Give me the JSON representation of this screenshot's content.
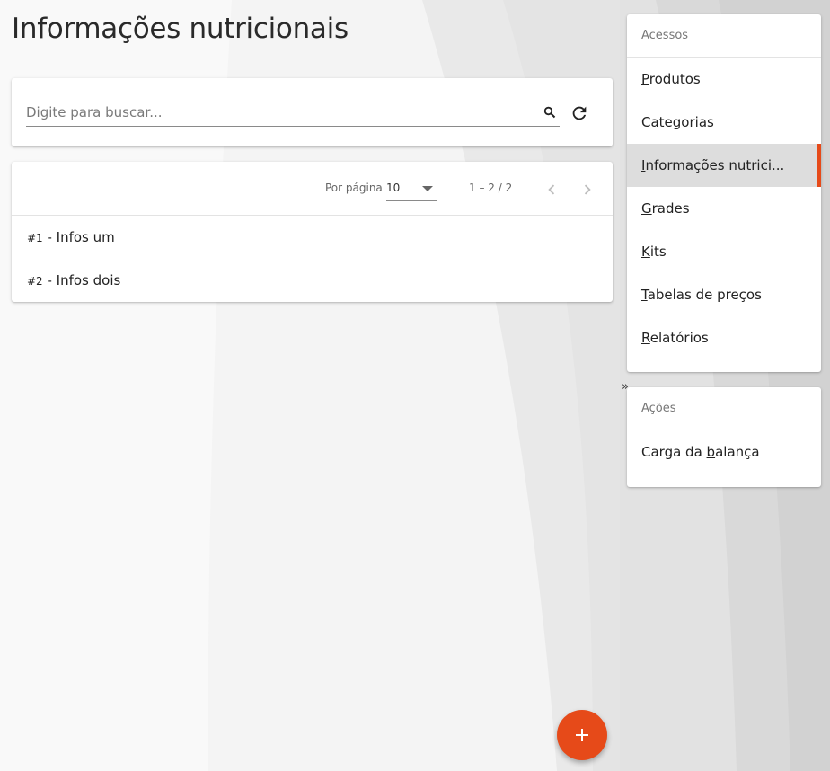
{
  "page": {
    "title": "Informações nutricionais"
  },
  "search": {
    "placeholder": "Digite para buscar...",
    "value": ""
  },
  "paginator": {
    "per_page_label": "Por página",
    "per_page_value": "10",
    "range_label": "1 – 2 / 2"
  },
  "list": {
    "items": [
      {
        "num": "#1",
        "label": " - Infos um"
      },
      {
        "num": "#2",
        "label": " - Infos dois"
      }
    ]
  },
  "sidebar": {
    "acessos": {
      "header": "Acessos",
      "items": [
        {
          "shortcut": "P",
          "rest": "rodutos"
        },
        {
          "shortcut": "C",
          "rest": "ategorias"
        },
        {
          "shortcut": "I",
          "rest": "nformações nutrici..."
        },
        {
          "shortcut": "G",
          "rest": "rades"
        },
        {
          "shortcut": "K",
          "rest": "its"
        },
        {
          "shortcut": "T",
          "rest": "abelas de preços"
        },
        {
          "shortcut": "R",
          "rest": "elatórios"
        }
      ],
      "active_index": 2
    },
    "collapse_toggle": "»",
    "acoes": {
      "header": "Ações",
      "items": [
        {
          "before": "Carga da ",
          "shortcut": "b",
          "after": "alança"
        }
      ]
    }
  },
  "colors": {
    "accent": "#e64a19",
    "active_bg": "#dddddd"
  },
  "icons": {
    "search": "search-icon",
    "refresh": "refresh-icon",
    "prev": "chevron-left-icon",
    "next": "chevron-right-icon",
    "add": "plus-icon"
  }
}
